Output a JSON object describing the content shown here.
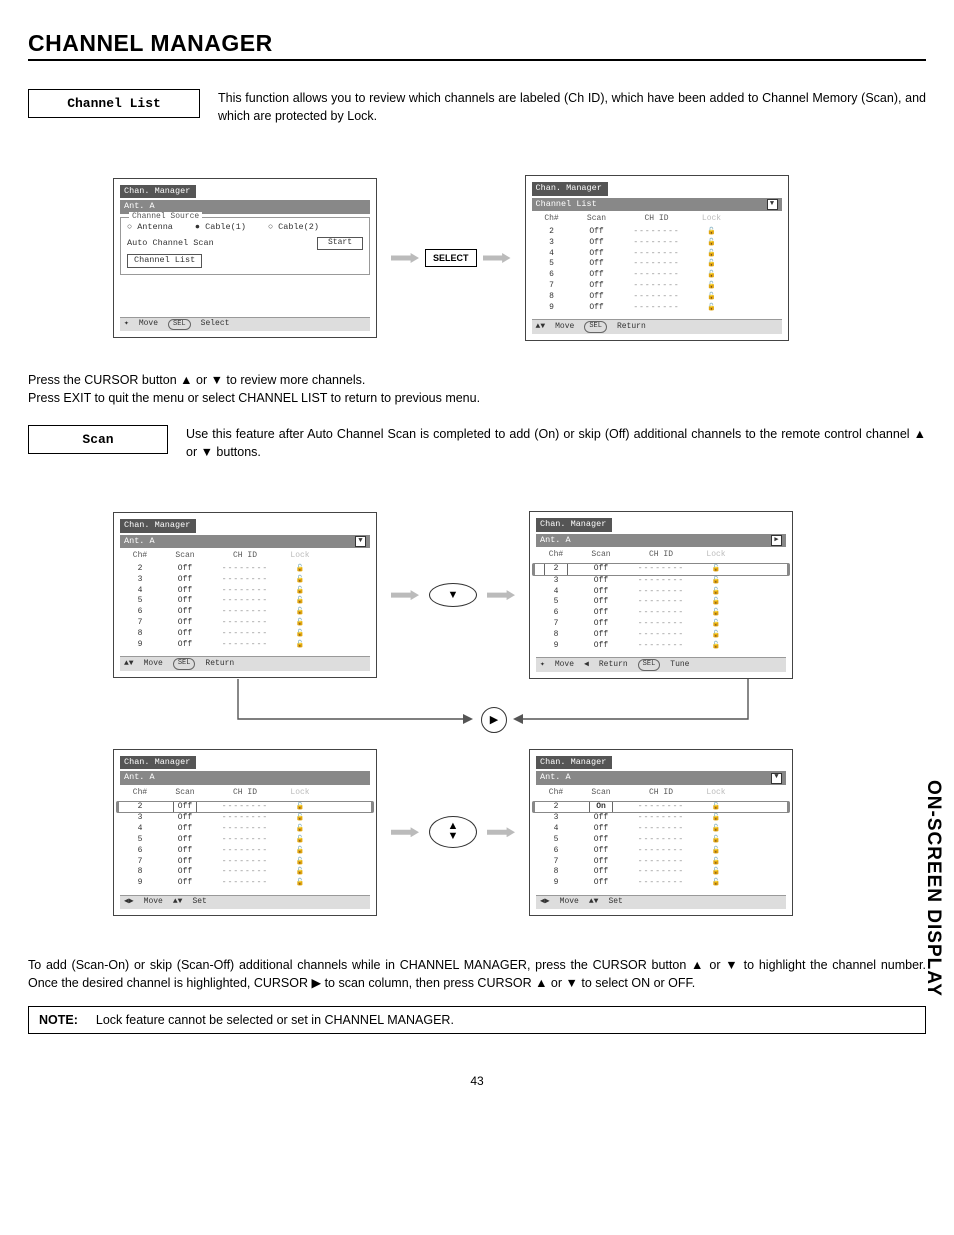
{
  "page": {
    "title": "CHANNEL MANAGER",
    "side_tab": "ON-SCREEN DISPLAY",
    "number": "43"
  },
  "section1": {
    "label": "Channel List",
    "desc": "This function allows you to review which channels are labeled (Ch ID), which have been added to Channel Memory (Scan), and which are protected by Lock.",
    "after1": "Press the CURSOR button ▲ or ▼ to review more channels.",
    "after2": "Press EXIT to quit the menu or select CHANNEL LIST to return to previous menu."
  },
  "section2": {
    "label": "Scan",
    "desc": "Use this feature after Auto Channel Scan is completed to add (On) or skip (Off) additional channels to the remote control channel ▲ or ▼ buttons."
  },
  "para_after": "To add (Scan-On) or skip (Scan-Off) additional channels while in CHANNEL MANAGER, press the CURSOR button ▲ or ▼ to highlight the channel number.  Once the desired channel is highlighted, CURSOR ▶ to scan column, then press CURSOR ▲ or ▼ to select ON or OFF.",
  "note": {
    "label": "NOTE:",
    "text": "Lock feature cannot be selected or set in CHANNEL MANAGER."
  },
  "ui": {
    "panel_title": "Chan. Manager",
    "ant": "Ant. A",
    "channel_list_sub": "Channel List",
    "fieldset": "Channel Source",
    "radios": {
      "antenna": "Antenna",
      "cable1": "Cable(1)",
      "cable2": "Cable(2)"
    },
    "auto_scan": "Auto Channel Scan",
    "start": "Start",
    "chan_list_btn": "Channel List",
    "select_btn": "SELECT",
    "headers": {
      "ch": "Ch#",
      "scan": "Scan",
      "chid": "CH ID",
      "lock": "Lock"
    },
    "rows_default": [
      {
        "ch": "2",
        "scan": "Off"
      },
      {
        "ch": "3",
        "scan": "Off"
      },
      {
        "ch": "4",
        "scan": "Off"
      },
      {
        "ch": "5",
        "scan": "Off"
      },
      {
        "ch": "6",
        "scan": "Off"
      },
      {
        "ch": "7",
        "scan": "Off"
      },
      {
        "ch": "8",
        "scan": "Off"
      },
      {
        "ch": "9",
        "scan": "Off"
      }
    ],
    "footer": {
      "move": "Move",
      "select": "Select",
      "return": "Return",
      "tune": "Tune",
      "set": "Set"
    },
    "on_value": "On",
    "off_value": "Off",
    "dashes": "--------"
  }
}
